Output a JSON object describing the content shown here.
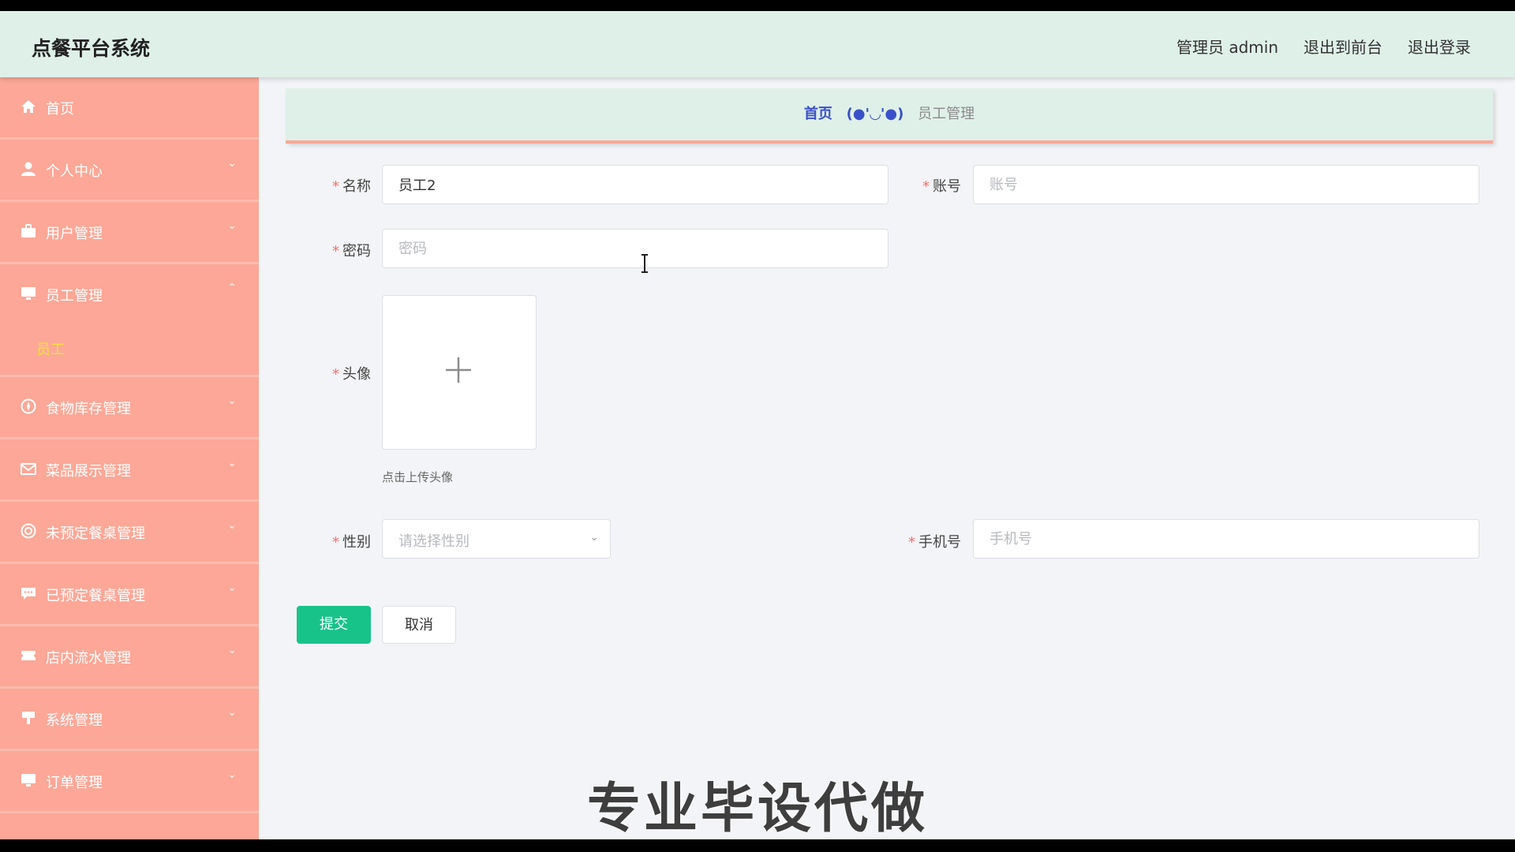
{
  "app": {
    "title": "点餐平台系统"
  },
  "topbar": {
    "user": "管理员 admin",
    "to_front": "退出到前台",
    "logout": "退出登录"
  },
  "sidebar": {
    "items": [
      {
        "label": "首页",
        "icon": "home-icon"
      },
      {
        "label": "个人中心",
        "icon": "user-icon"
      },
      {
        "label": "用户管理",
        "icon": "briefcase-icon"
      },
      {
        "label": "员工管理",
        "icon": "monitor-icon",
        "expanded": true,
        "sub": [
          "员工"
        ]
      },
      {
        "label": "食物库存管理",
        "icon": "compass-icon"
      },
      {
        "label": "菜品展示管理",
        "icon": "mail-icon"
      },
      {
        "label": "未预定餐桌管理",
        "icon": "target-icon"
      },
      {
        "label": "已预定餐桌管理",
        "icon": "chat-icon"
      },
      {
        "label": "店内流水管理",
        "icon": "ticket-icon"
      },
      {
        "label": "系统管理",
        "icon": "podium-icon"
      },
      {
        "label": "订单管理",
        "icon": "monitor-icon"
      }
    ]
  },
  "breadcrumb": {
    "home": "首页",
    "sep": "(●'◡'●)",
    "current": "员工管理"
  },
  "form": {
    "name": {
      "label": "名称",
      "value": "员工2"
    },
    "account": {
      "label": "账号",
      "placeholder": "账号"
    },
    "password": {
      "label": "密码",
      "placeholder": "密码"
    },
    "avatar": {
      "label": "头像",
      "hint": "点击上传头像"
    },
    "gender": {
      "label": "性别",
      "placeholder": "请选择性别"
    },
    "phone": {
      "label": "手机号",
      "placeholder": "手机号"
    },
    "submit": "提交",
    "cancel": "取消"
  },
  "watermark": "专业毕设代做",
  "colors": {
    "sidebar": "#fca797",
    "header": "#dff0e9",
    "submit": "#18c389",
    "active_sub": "#f7e23a"
  }
}
